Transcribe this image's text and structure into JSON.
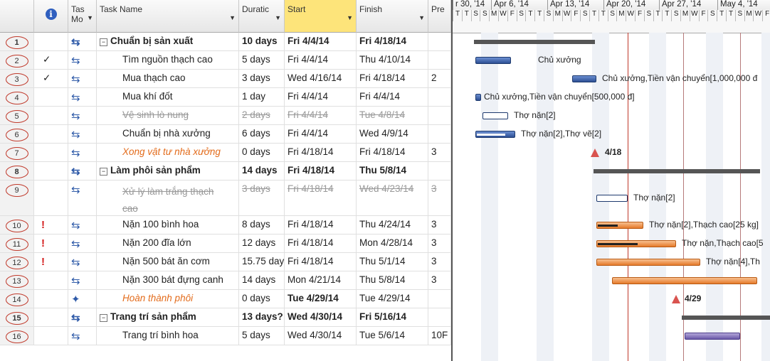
{
  "headers": {
    "id": "",
    "info": "i",
    "task_mode": "Tas Mo",
    "task_name": "Task Name",
    "duration": "Duratic",
    "start": "Start",
    "finish": "Finish",
    "predecessors": "Pre"
  },
  "timescale": {
    "weeks": [
      "r 30, '14",
      "Apr 6, '14",
      "Apr 13, '14",
      "Apr 20, '14",
      "Apr 27, '14",
      "May 4, '14"
    ],
    "days": [
      "T",
      "T",
      "S",
      "S",
      "M",
      "W",
      "F",
      "S",
      "T",
      "T",
      "S",
      "M",
      "W",
      "F",
      "S",
      "T",
      "T",
      "S",
      "M",
      "W",
      "F",
      "S",
      "T",
      "T",
      "S",
      "M",
      "W",
      "F",
      "S",
      "T",
      "T",
      "S",
      "M",
      "W",
      "F",
      "S"
    ]
  },
  "tasks": [
    {
      "id": "1",
      "check": "",
      "indicator": "",
      "name": "Chuẩn bị sản xuất",
      "duration": "10 days",
      "start": "Fri 4/4/14",
      "finish": "Fri 4/18/14",
      "pred": "",
      "summary": true,
      "style": "normal"
    },
    {
      "id": "2",
      "check": "✓",
      "indicator": "",
      "name": "Tìm nguồn thạch cao",
      "duration": "5 days",
      "start": "Fri 4/4/14",
      "finish": "Thu 4/10/14",
      "pred": "",
      "summary": false,
      "style": "normal"
    },
    {
      "id": "3",
      "check": "✓",
      "indicator": "",
      "name": "Mua thạch cao",
      "duration": "3 days",
      "start": "Wed 4/16/14",
      "finish": "Fri 4/18/14",
      "pred": "2",
      "summary": false,
      "style": "normal"
    },
    {
      "id": "4",
      "check": "",
      "indicator": "",
      "name": "Mua khí đốt",
      "duration": "1 day",
      "start": "Fri 4/4/14",
      "finish": "Fri 4/4/14",
      "pred": "",
      "summary": false,
      "style": "normal"
    },
    {
      "id": "5",
      "check": "",
      "indicator": "",
      "name": "Vệ sinh lò nung",
      "duration": "2 days",
      "start": "Fri 4/4/14",
      "finish": "Tue 4/8/14",
      "pred": "",
      "summary": false,
      "style": "strike"
    },
    {
      "id": "6",
      "check": "",
      "indicator": "",
      "name": "Chuẩn bị nhà xưởng",
      "duration": "6 days",
      "start": "Fri 4/4/14",
      "finish": "Wed 4/9/14",
      "pred": "",
      "summary": false,
      "style": "normal"
    },
    {
      "id": "7",
      "check": "",
      "indicator": "",
      "name": "Xong vật tư nhà xưởng",
      "duration": "0 days",
      "start": "Fri 4/18/14",
      "finish": "Fri 4/18/14",
      "pred": "3",
      "summary": false,
      "style": "milestone"
    },
    {
      "id": "8",
      "check": "",
      "indicator": "",
      "name": "Làm phôi sản phẩm",
      "duration": "14 days",
      "start": "Fri 4/18/14",
      "finish": "Thu 5/8/14",
      "pred": "",
      "summary": true,
      "style": "normal"
    },
    {
      "id": "9",
      "check": "",
      "indicator": "",
      "name": "Xử lý làm trắng thạch",
      "name2": "cao",
      "duration": "3 days",
      "start": "Fri 4/18/14",
      "finish": "Wed 4/23/14",
      "pred": "3",
      "summary": false,
      "style": "strike"
    },
    {
      "id": "10",
      "check": "",
      "indicator": "!",
      "name": "Nặn 100 bình hoa",
      "duration": "8 days",
      "start": "Fri 4/18/14",
      "finish": "Thu 4/24/14",
      "pred": "3",
      "summary": false,
      "style": "normal"
    },
    {
      "id": "11",
      "check": "",
      "indicator": "!",
      "name": "Nặn 200 đĩa lớn",
      "duration": "12 days",
      "start": "Fri 4/18/14",
      "finish": "Mon 4/28/14",
      "pred": "3",
      "summary": false,
      "style": "normal"
    },
    {
      "id": "12",
      "check": "",
      "indicator": "!",
      "name": "Nặn 500 bát ăn cơm",
      "duration": "15.75 day",
      "start": "Fri 4/18/14",
      "finish": "Thu 5/1/14",
      "pred": "3",
      "summary": false,
      "style": "normal"
    },
    {
      "id": "13",
      "check": "",
      "indicator": "",
      "name": "Nặn 300 bát đựng canh",
      "duration": "14 days",
      "start": "Mon 4/21/14",
      "finish": "Thu 5/8/14",
      "pred": "3",
      "summary": false,
      "style": "normal"
    },
    {
      "id": "14",
      "check": "",
      "indicator": "",
      "name": "Hoàn thành phôi",
      "duration": "0 days",
      "start": "Tue 4/29/14",
      "finish": "Tue 4/29/14",
      "pred": "",
      "summary": false,
      "style": "milestone",
      "bold_dates": true
    },
    {
      "id": "15",
      "check": "",
      "indicator": "",
      "name": "Trang trí sản phẩm",
      "duration": "13 days?",
      "start": "Wed 4/30/14",
      "finish": "Fri 5/16/14",
      "pred": "",
      "summary": true,
      "style": "normal"
    },
    {
      "id": "16",
      "check": "",
      "indicator": "",
      "name": "Trang trí bình hoa",
      "duration": "5 days",
      "start": "Wed 4/30/14",
      "finish": "Tue 5/6/14",
      "pred": "10F",
      "summary": false,
      "style": "normal"
    }
  ],
  "gantt_labels": {
    "l2": "Chủ xưởng",
    "l3": "Chủ xưởng,Tiền vận chuyển[1,000,000 đ",
    "l4": "Chủ xưởng,Tiền vận chuyển[500,000 đ]",
    "l5": "Thợ nặn[2]",
    "l6": "Thợ nặn[2],Thợ vẽ[2]",
    "l7": "4/18",
    "l9": "Thợ nặn[2]",
    "l10": "Thợ nặn[2],Thạch cao[25 kg]",
    "l11": "Thợ nặn,Thạch cao[5",
    "l12": "Thợ nặn[4],Th",
    "l14": "4/29"
  },
  "colors": {
    "selected_header": "#fde47a",
    "bar_blue": "#2d4f94",
    "bar_orange": "#e57a2a",
    "milestone": "#d9534f",
    "today_line": "#c0392b"
  }
}
